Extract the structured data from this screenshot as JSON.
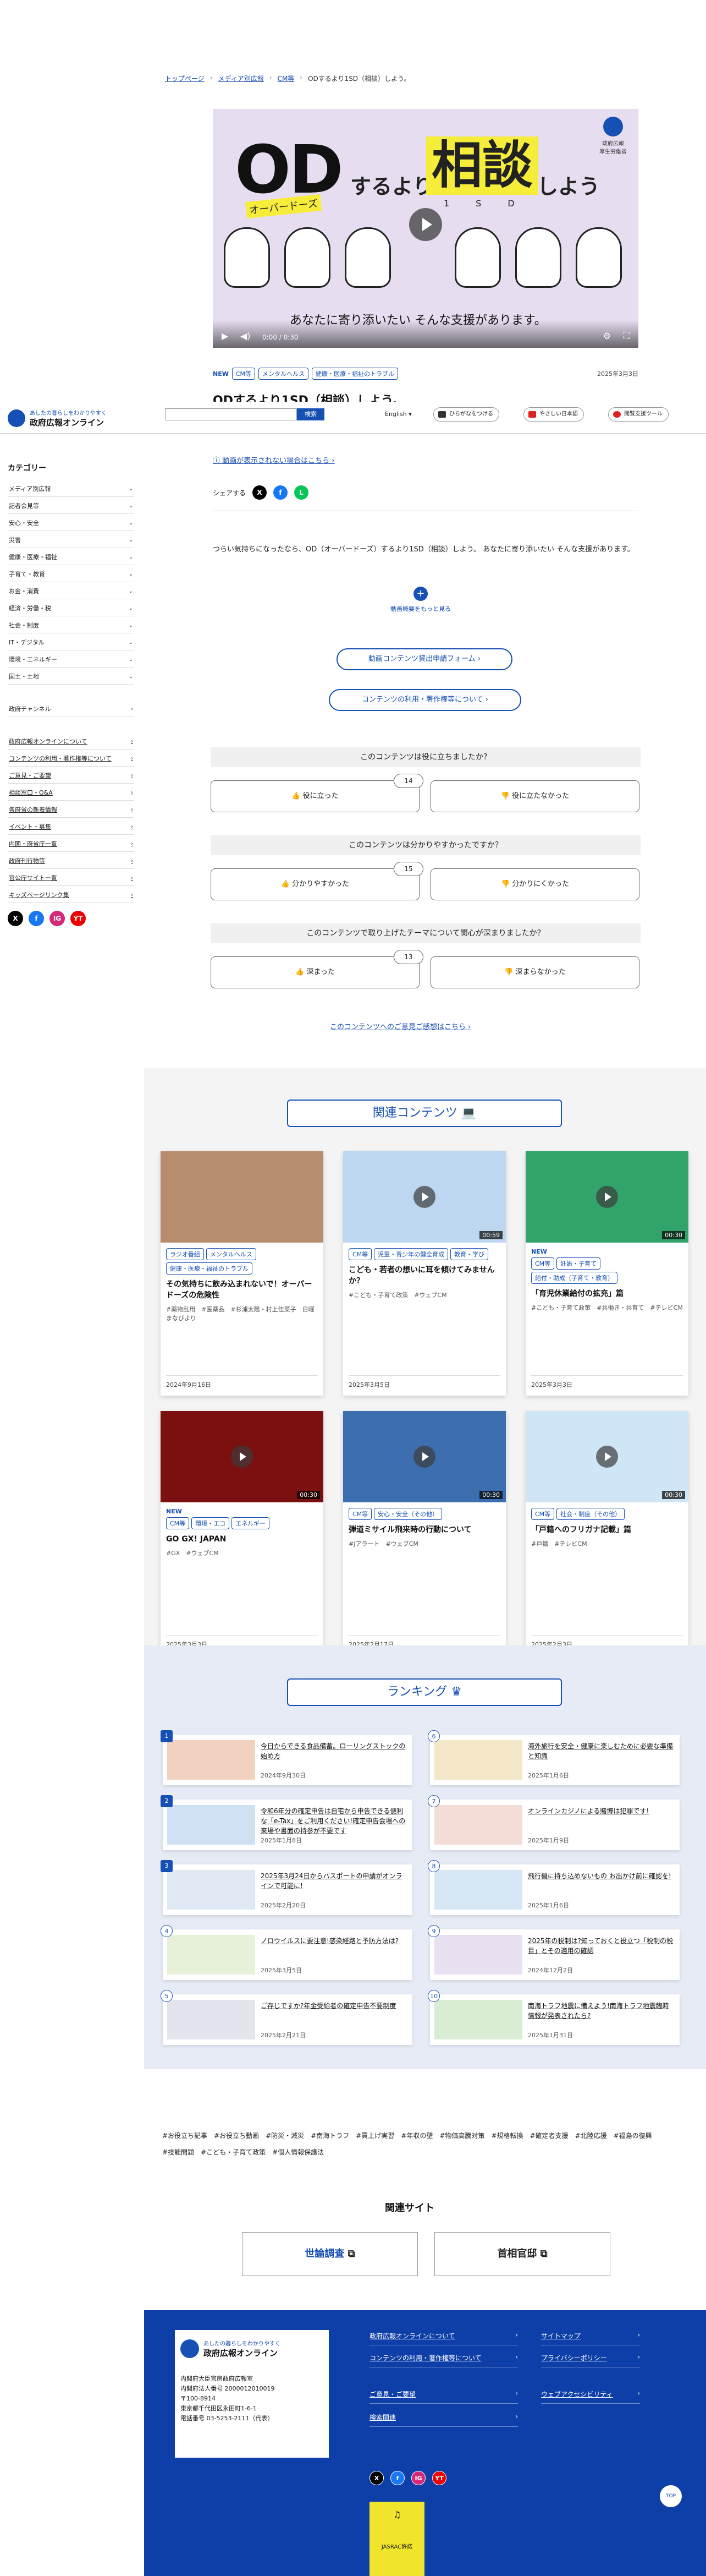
{
  "breadcrumb": [
    "トップページ",
    "メディア別広報",
    "CM等",
    "ODするより1SD（相談）しよう。"
  ],
  "video": {
    "od": "OD",
    "od_ruby": "オーバードーズ",
    "suru": "するより",
    "soudan": "相談",
    "soudan_ruby": "1SD",
    "shiyou": "しよう",
    "tagline": "あなたに寄り添いたい そんな支援があります。",
    "logo_text": "政府広報\n厚生労働省",
    "time": "0:00 / 0:30"
  },
  "content_tags": {
    "new": "NEW",
    "items": [
      "CM等",
      "メンタルヘルス",
      "健康・医療・福祉のトラブル"
    ],
    "date": "2025年3月3日"
  },
  "page_title": "ODするより1SD（相談）しよう。",
  "header": {
    "logo_tagline": "あしたの暮らしをわかりやすく",
    "logo_name": "政府広報オンライン",
    "search_button": "検索",
    "language": "English",
    "utility": [
      "ひらがなをつける",
      "やさしい日本語",
      "閲覧支援ツール"
    ]
  },
  "sidebar": {
    "category_title": "カテゴリー",
    "categories": [
      "メディア別広報",
      "記者会見等",
      "安心・安全",
      "災害",
      "健康・医療・福祉",
      "子育て・教育",
      "お金・消費",
      "経済・労働・税",
      "社会・制度",
      "IT・デジタル",
      "環境・エネルギー",
      "国土・土地"
    ],
    "channel": "政府チャンネル",
    "links": [
      "政府広報オンラインについて",
      "コンテンツの利用・著作権等について",
      "ご意見・ご要望",
      "相談窓口・Q&A",
      "各府省の新着情報",
      "イベント・募集",
      "内閣・府省庁一覧",
      "政府刊行物等",
      "官公庁サイト一覧",
      "キッズページリンク集"
    ],
    "social": [
      "X",
      "f",
      "IG",
      "YT"
    ]
  },
  "main": {
    "help_link": "動画が表示されない場合はこちら",
    "share_label": "シェアする",
    "description": "つらい気持ちになったなら、OD（オーバードーズ）するより1SD（相談）しよう。 あなたに寄り添いたい そんな支援があります。",
    "more_label": "動画概要をもっと見る",
    "apply_button": "動画コンテンツ貸出申請フォーム",
    "copyright_button": "コンテンツの利用・著作権等について",
    "feedback_link": "このコンテンツへのご意見ご感想はこちら"
  },
  "surveys": [
    {
      "question": "このコンテンツは役に立ちましたか？",
      "yes": "役に立った",
      "no": "役に立たなかった",
      "count": "14"
    },
    {
      "question": "このコンテンツは分かりやすかったですか？",
      "yes": "分かりやすかった",
      "no": "分かりにくかった",
      "count": "15"
    },
    {
      "question": "このコンテンツで取り上げたテーマについて関心が深まりましたか？",
      "yes": "深まった",
      "no": "深まらなかった",
      "count": "13"
    }
  ],
  "related": {
    "title": "関連コンテンツ",
    "cards": [
      {
        "tags": [
          "ラジオ番組",
          "メンタルヘルス",
          "健康・医療・福祉のトラブル"
        ],
        "title": "その気持ちに飲み込まれないで！オーバードーズの危険性",
        "hash": "#薬物乱用　#医薬品　#杉浦太陽・村上佳菜子　日曜まなびより",
        "date": "2024年9月16日",
        "duration": "",
        "thumb": "#b88d6e",
        "new": ""
      },
      {
        "tags": [
          "CM等",
          "児童・青少年の健全育成",
          "教育・学び"
        ],
        "title": "こども・若者の想いに耳を傾けてみませんか？",
        "hash": "#こども・子育て政策　#ウェブCM",
        "date": "2025年3月5日",
        "duration": "00:59",
        "thumb": "#bcd7ef",
        "new": ""
      },
      {
        "tags": [
          "CM等",
          "妊娠・子育て",
          "給付・助成（子育て・教育）"
        ],
        "title": "「育児休業給付の拡充」篇",
        "hash": "#こども・子育て政策　#共働き・共育て　#テレビCM",
        "date": "2025年3月3日",
        "duration": "00:30",
        "thumb": "#31a36b",
        "new": "NEW"
      },
      {
        "tags": [
          "CM等",
          "環境・エコ",
          "エネルギー"
        ],
        "title": "GO GX! JAPAN",
        "hash": "#GX　#ウェブCM",
        "date": "2025年3月3日",
        "duration": "00:30",
        "thumb": "#7a1010",
        "new": "NEW"
      },
      {
        "tags": [
          "CM等",
          "安心・安全（その他）"
        ],
        "title": "弾道ミサイル飛来時の行動について",
        "hash": "#Jアラート　#ウェブCM",
        "date": "2025年2月17日",
        "duration": "00:30",
        "thumb": "#3d6fb0",
        "new": ""
      },
      {
        "tags": [
          "CM等",
          "社会・制度（その他）"
        ],
        "title": "「戸籍へのフリガナ記載」篇",
        "hash": "#戸籍　#テレビCM",
        "date": "2025年2月3日",
        "duration": "00:30",
        "thumb": "#cfe6f7",
        "new": ""
      }
    ]
  },
  "ranking": {
    "title": "ランキング",
    "items": [
      {
        "num": "1",
        "title": "今日からできる食品備蓄。ローリングストックの始め方",
        "date": "2024年9月30日"
      },
      {
        "num": "2",
        "title": "令和6年分の確定申告は自宅から申告できる便利な「e-Tax」をご利用ください!確定申告会場への来場や書面の持参が不要です",
        "date": "2025年1月8日"
      },
      {
        "num": "3",
        "title": "2025年3月24日からパスポートの申請がオンラインで可能に!",
        "date": "2025年2月20日"
      },
      {
        "num": "4",
        "title": "ノロウイルスに要注意!感染経路と予防方法は?",
        "date": "2025年3月5日"
      },
      {
        "num": "5",
        "title": "ご存じですか?年金受給者の確定申告不要制度",
        "date": "2025年2月21日"
      },
      {
        "num": "6",
        "title": "海外旅行を安全・健康に楽しむために必要な準備と知識",
        "date": "2025年1月6日"
      },
      {
        "num": "7",
        "title": "オンラインカジノによる賭博は犯罪です!",
        "date": "2025年1月9日"
      },
      {
        "num": "8",
        "title": "飛行機に持ち込めないもの お出かけ前に確認を!",
        "date": "2025年1月6日"
      },
      {
        "num": "9",
        "title": "2025年の税制は?知っておくと役立つ「税制の税目」とその適用の確認",
        "date": "2024年12月2日"
      },
      {
        "num": "10",
        "title": "南海トラフ地震に備えよう!南海トラフ地震臨時情報が発表されたら?",
        "date": "2025年1月31日"
      }
    ]
  },
  "tag_cloud": [
    "#お役立ち記事",
    "#お役立ち動画",
    "#防災・減災",
    "#南海トラフ",
    "#買上げ実習",
    "#年収の壁",
    "#物価高騰対策",
    "#規格転換",
    "#確定者支援",
    "#北陸応援",
    "#福島の復興",
    "#技能問題",
    "#こども・子育て政策",
    "#個人情報保護法"
  ],
  "related_sites": {
    "title": "関連サイト",
    "items": [
      "世論調査",
      "首相官邸"
    ]
  },
  "footer": {
    "tagline": "あしたの暮らしをわかりやすく",
    "name": "政府広報オンライン",
    "address": [
      "内閣府大臣官房政府広報室",
      "内閣府法人番号 2000012010019",
      "〒100-8914",
      "東京都千代田区永田町1-6-1",
      "電話番号 03-5253-2111（代表）"
    ],
    "links_left": [
      "政府広報オンラインについて",
      "コンテンツの利用・著作権等について",
      "ご意見・ご要望",
      "検索関連"
    ],
    "links_right": [
      "サイトマップ",
      "プライバシーポリシー",
      "ウェブアクセシビリティ"
    ],
    "page_top": "TOP",
    "jas_text": "JASRAC許諾"
  },
  "colors": {
    "accent": "#1650b4",
    "footer": "#0e3fa8",
    "highlight": "#f6ec3a"
  }
}
